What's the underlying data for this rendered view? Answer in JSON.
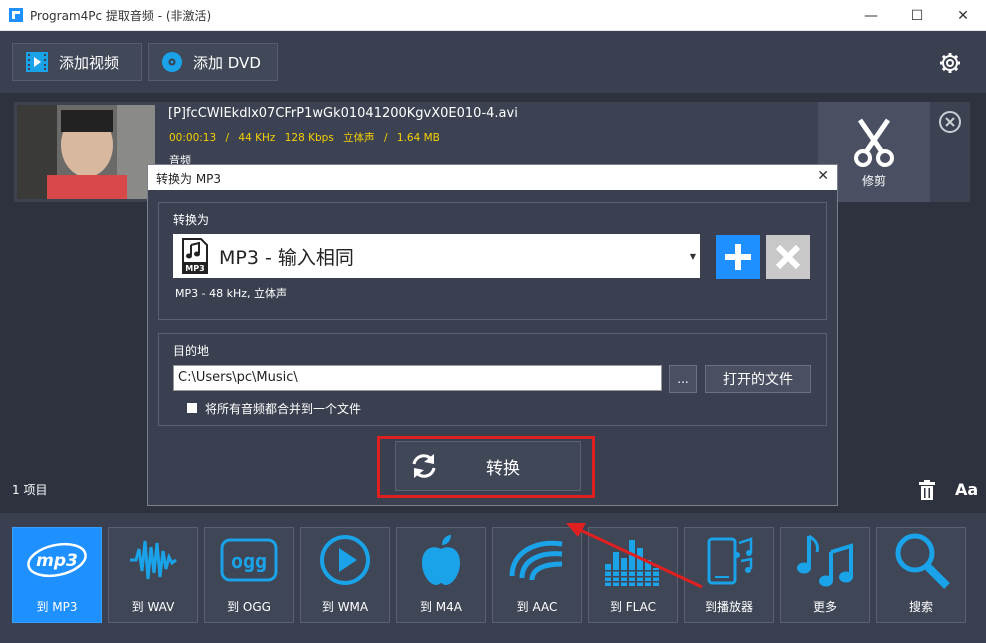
{
  "window": {
    "title": "Program4Pc 提取音频 - (非激活)",
    "minimize": "—",
    "maximize": "☐",
    "close": "✕"
  },
  "toolbar": {
    "add_video": "添加视频",
    "add_dvd": "添加 DVD"
  },
  "file_item": {
    "name": "[P]fcCWIEkdlx07CFrP1wGk01041200KgvX0E010-4.avi",
    "duration": "00:00:13",
    "sep": "/",
    "sample_rate": "44 KHz",
    "bitrate": "128 Kbps",
    "channels": "立体声",
    "size": "1.64 MB",
    "track_label": "音频",
    "trim_label": "修剪"
  },
  "status": {
    "item_count": "1 项目",
    "font_button": "Aa"
  },
  "formats": [
    {
      "label": "到 MP3",
      "icon": "mp3-icon",
      "active": true
    },
    {
      "label": "到 WAV",
      "icon": "waveform-icon"
    },
    {
      "label": "到 OGG",
      "icon": "ogg-icon"
    },
    {
      "label": "到 WMA",
      "icon": "play-circle-icon"
    },
    {
      "label": "到 M4A",
      "icon": "apple-icon"
    },
    {
      "label": "到 AAC",
      "icon": "aac-waves-icon"
    },
    {
      "label": "到 FLAC",
      "icon": "equalizer-icon"
    },
    {
      "label": "到播放器",
      "icon": "phone-music-icon"
    },
    {
      "label": "更多",
      "icon": "music-notes-icon"
    },
    {
      "label": "搜索",
      "icon": "search-icon"
    }
  ],
  "dialog": {
    "title": "转换为 MP3",
    "close": "✕",
    "convert_to_label": "转换为",
    "selected_format": "MP3 - 输入相同",
    "format_description": "MP3 - 48 kHz, 立体声",
    "destination_label": "目的地",
    "destination_path": "C:\\Users\\pc\\Music\\",
    "browse": "...",
    "open_folder": "打开的文件",
    "merge_label": "将所有音频都合并到一个文件",
    "convert_button": "转换"
  },
  "colors": {
    "accent": "#1e90ff",
    "highlight": "#e02020",
    "meta_text": "#f5d000"
  }
}
